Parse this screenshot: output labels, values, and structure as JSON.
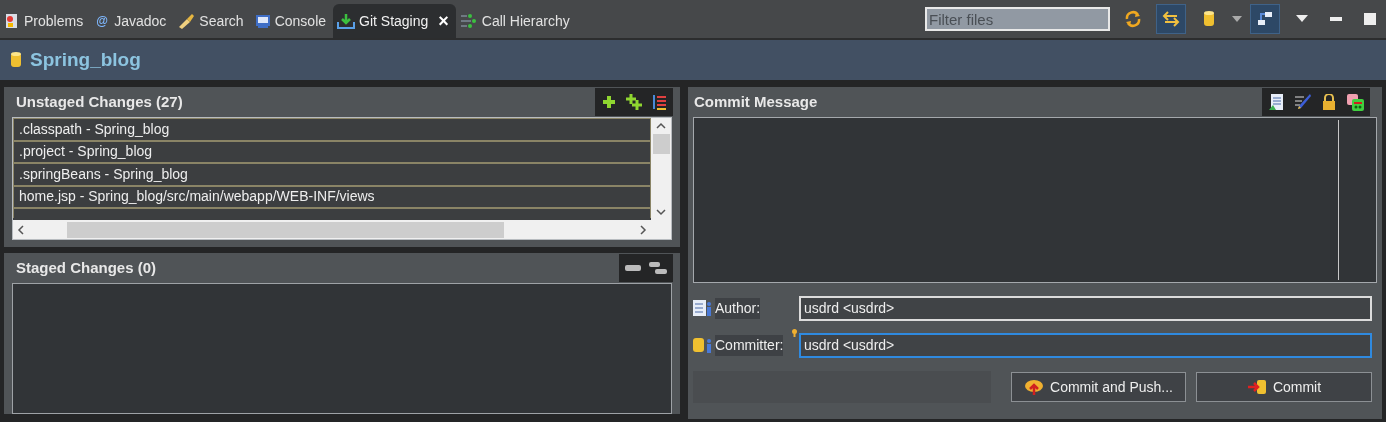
{
  "tabs": [
    {
      "label": "Problems",
      "kind": "problems",
      "selected": false
    },
    {
      "label": "Javadoc",
      "kind": "javadoc",
      "glyph": "@",
      "selected": false
    },
    {
      "label": "Search",
      "kind": "search",
      "selected": false
    },
    {
      "label": "Console",
      "kind": "console",
      "selected": false
    },
    {
      "label": "Git Staging",
      "kind": "staging",
      "selected": true,
      "close": "×"
    },
    {
      "label": "Call Hierarchy",
      "kind": "hierarchy",
      "selected": false
    }
  ],
  "toolbar": {
    "filter": {
      "placeholder": "Filter files"
    },
    "toggles": [
      {
        "kind": "refresh",
        "selected": false
      },
      {
        "kind": "link",
        "selected": true
      },
      {
        "kind": "repo",
        "selected": false
      },
      {
        "kind": "layout",
        "selected": true
      }
    ]
  },
  "repository": {
    "name": "Spring_blog"
  },
  "unstaged": {
    "title": "Unstaged Changes (27)",
    "files": [
      {
        "label": ".classpath - Spring_blog"
      },
      {
        "label": ".project - Spring_blog"
      },
      {
        "label": ".springBeans - Spring_blog"
      },
      {
        "label": "home.jsp - Spring_blog/src/main/webapp/WEB-INF/views"
      }
    ]
  },
  "staged": {
    "title": "Staged Changes (0)"
  },
  "commit": {
    "title": "Commit Message",
    "author": {
      "label": "Author:",
      "value": "usdrd <usdrd>"
    },
    "committer": {
      "label": "Committer:",
      "value": "usdrd <usdrd>"
    },
    "buttons": [
      {
        "label": "Commit and Push...",
        "kind": "push"
      },
      {
        "label": "Commit",
        "kind": "commit"
      }
    ]
  }
}
